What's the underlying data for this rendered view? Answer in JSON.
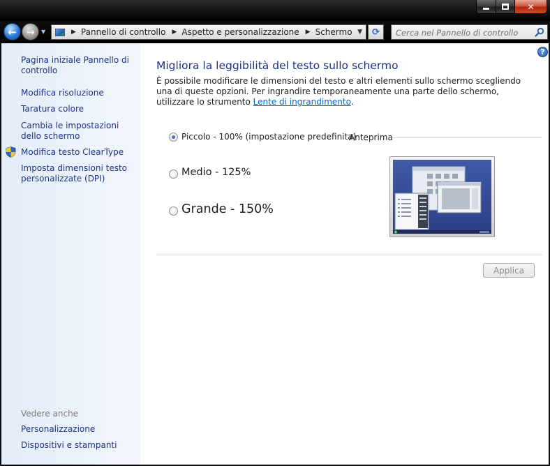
{
  "window": {
    "minimize_symbol": "",
    "maximize_symbol": "",
    "close_symbol": "✕"
  },
  "nav": {
    "back_symbol": "←",
    "forward_symbol": "→",
    "breadcrumbs": [
      "Pannello di controllo",
      "Aspetto e personalizzazione",
      "Schermo"
    ],
    "search_placeholder": "Cerca nel Pannello di controllo"
  },
  "sidebar": {
    "links": [
      "Pagina iniziale Pannello di controllo",
      "Modifica risoluzione",
      "Taratura colore",
      "Cambia le impostazioni dello schermo",
      "Modifica testo ClearType",
      "Imposta dimensioni testo personalizzate (DPI)"
    ],
    "see_also_title": "Vedere anche",
    "see_also_links": [
      "Personalizzazione",
      "Dispositivi e stampanti"
    ]
  },
  "main": {
    "title": "Migliora la leggibilità del testo sullo schermo",
    "description": "È possibile modificare le dimensioni del testo e altri elementi sullo schermo scegliendo una di queste opzioni. Per ingrandire temporaneamente una parte dello schermo, utilizzare lo strumento",
    "description_link": "Lente di ingrandimento",
    "description_end": ".",
    "options": [
      {
        "label": "Piccolo - 100% (impostazione predefinita)",
        "selected": true
      },
      {
        "label": "Medio - 125%",
        "selected": false
      },
      {
        "label": "Grande - 150%",
        "selected": false
      }
    ],
    "preview_label": "Anteprima",
    "apply_label": "Applica",
    "apply_enabled": false,
    "help_symbol": "?"
  },
  "colors": {
    "link": "#1e3287",
    "inline_link": "#0066cc",
    "sidebar_bg": "#e3ecf7"
  }
}
